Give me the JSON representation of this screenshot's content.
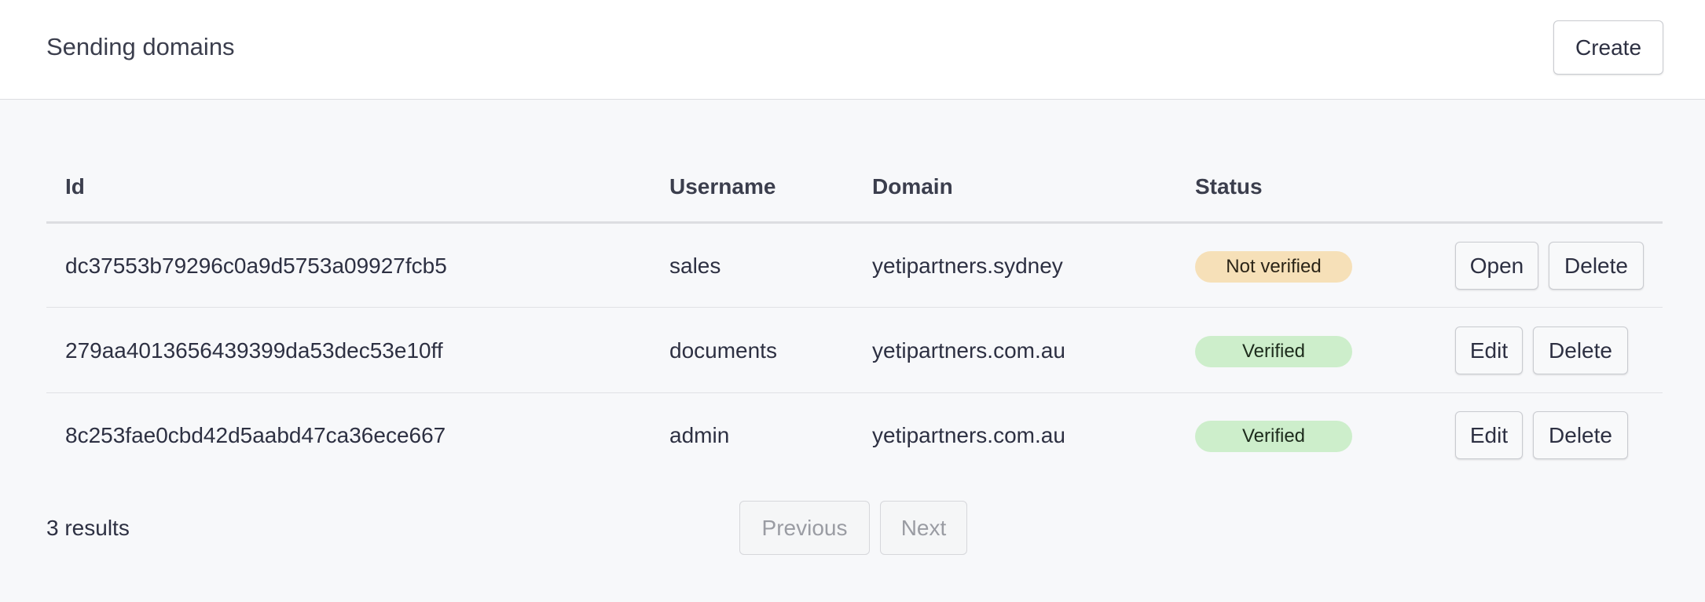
{
  "header": {
    "title": "Sending domains",
    "create_label": "Create"
  },
  "table": {
    "columns": [
      "Id",
      "Username",
      "Domain",
      "Status"
    ],
    "rows": [
      {
        "id": "dc37553b79296c0a9d5753a09927fcb5",
        "username": "sales",
        "domain": "yetipartners.sydney",
        "status": "Not verified",
        "status_color": "#f6e0b8",
        "actions": [
          "Open",
          "Delete"
        ]
      },
      {
        "id": "279aa4013656439399da53dec53e10ff",
        "username": "documents",
        "domain": "yetipartners.com.au",
        "status": "Verified",
        "status_color": "#cdeecb",
        "actions": [
          "Edit",
          "Delete"
        ]
      },
      {
        "id": "8c253fae0cbd42d5aabd47ca36ece667",
        "username": "admin",
        "domain": "yetipartners.com.au",
        "status": "Verified",
        "status_color": "#cdeecb",
        "actions": [
          "Edit",
          "Delete"
        ]
      }
    ]
  },
  "footer": {
    "results_text": "3 results",
    "previous_label": "Previous",
    "next_label": "Next"
  }
}
